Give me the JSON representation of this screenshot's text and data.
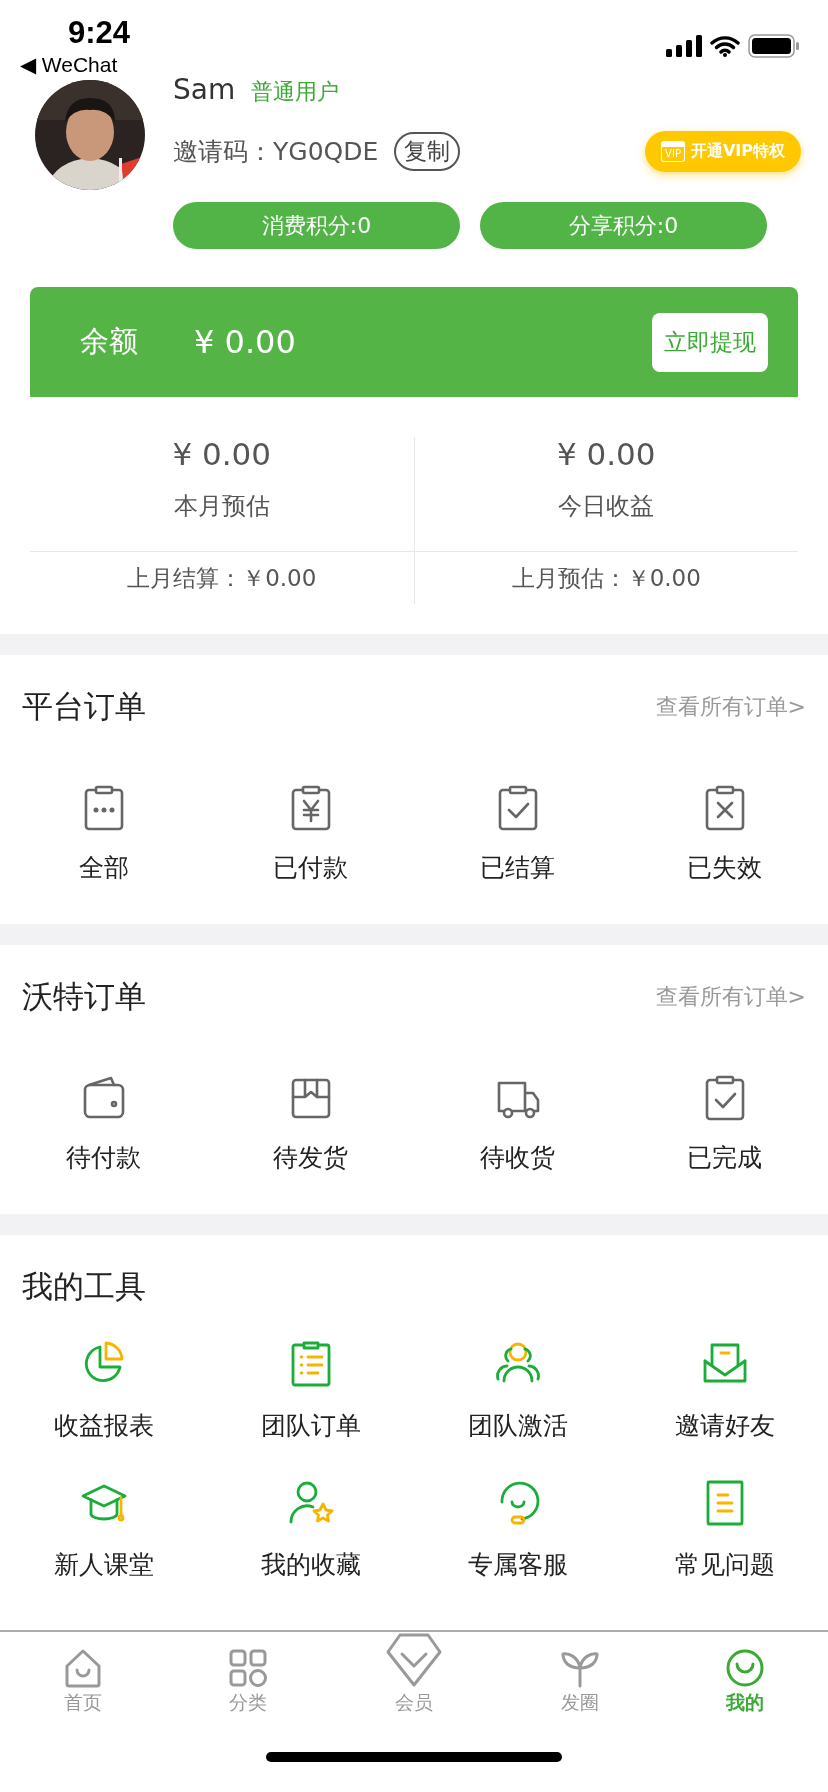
{
  "status_bar": {
    "time": "9:24",
    "back_app": "◀ WeChat"
  },
  "profile": {
    "name": "Sam",
    "level": "普通用户",
    "invite_label": "邀请码：YG0QDE",
    "copy_button": "复制",
    "vip_button": "开通VIP特权",
    "vip_badge": "VIP",
    "points": [
      "消费积分:0",
      "分享积分:0"
    ]
  },
  "balance": {
    "label": "余额",
    "amount": "¥ 0.00",
    "withdraw_button": "立即提现"
  },
  "stats": [
    {
      "value": "¥ 0.00",
      "label": "本月预估"
    },
    {
      "value": "¥ 0.00",
      "label": "今日收益"
    }
  ],
  "settlements": [
    "上月结算：￥0.00",
    "上月预估：￥0.00"
  ],
  "sections": [
    {
      "title": "平台订单",
      "link": "查看所有订单>",
      "items": [
        "全部",
        "已付款",
        "已结算",
        "已失效"
      ]
    },
    {
      "title": "沃特订单",
      "link": "查看所有订单>",
      "items": [
        "待付款",
        "待发货",
        "待收货",
        "已完成"
      ]
    }
  ],
  "tools": {
    "title": "我的工具",
    "items": [
      "收益报表",
      "团队订单",
      "团队激活",
      "邀请好友",
      "新人课堂",
      "我的收藏",
      "专属客服",
      "常见问题"
    ]
  },
  "tab_bar": [
    {
      "label": "首页",
      "selected": false
    },
    {
      "label": "分类",
      "selected": false
    },
    {
      "label": "会员",
      "selected": false
    },
    {
      "label": "发圈",
      "selected": false
    },
    {
      "label": "我的",
      "selected": true
    }
  ]
}
